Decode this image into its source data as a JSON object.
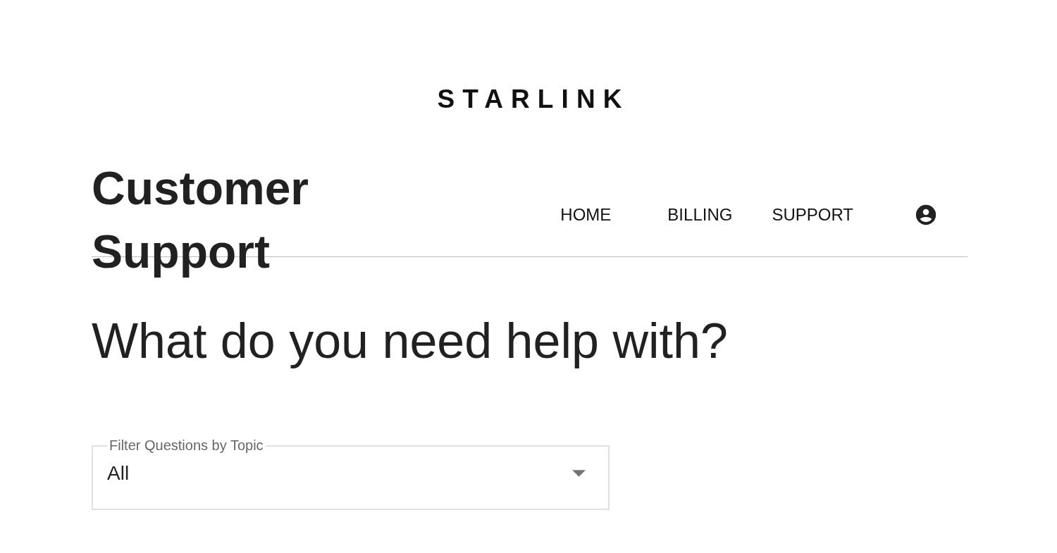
{
  "logo": "STARLINK",
  "title": "Customer Support",
  "nav": [
    {
      "label": "HOME"
    },
    {
      "label": "BILLING"
    },
    {
      "label": "SUPPORT"
    }
  ],
  "heading": "What do you need help with?",
  "filter": {
    "label": "Filter Questions by Topic",
    "value": "All"
  }
}
